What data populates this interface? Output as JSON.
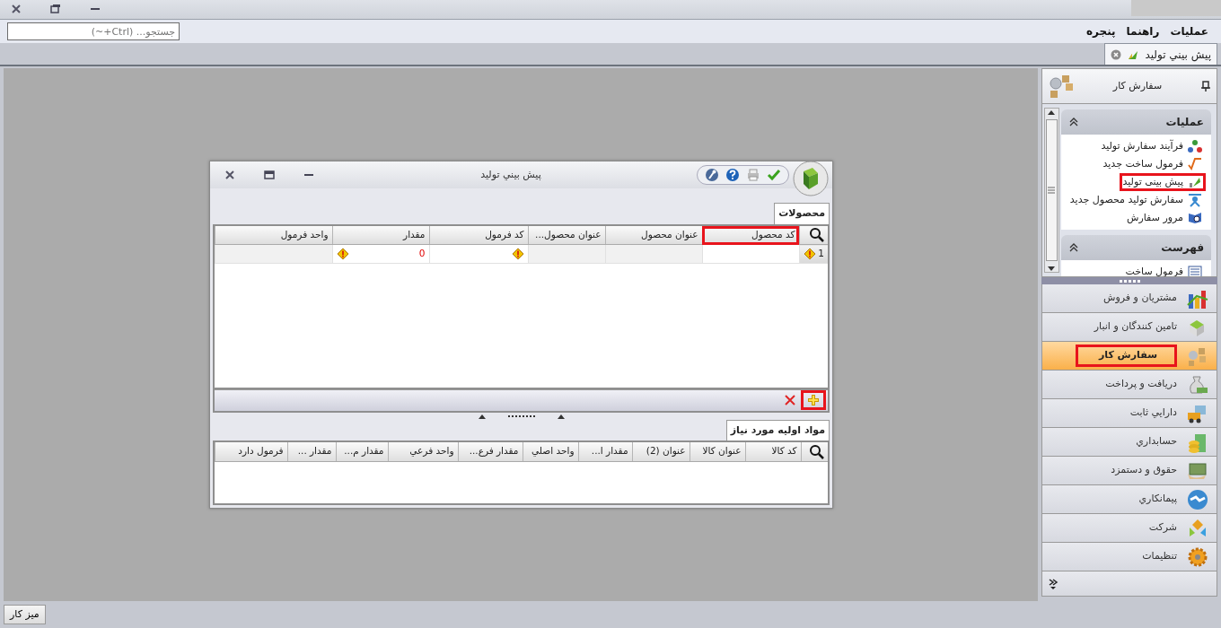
{
  "menu": [
    {
      "label": "عملیات"
    },
    {
      "label": "راهنما"
    },
    {
      "label": "پنجره"
    }
  ],
  "search": {
    "placeholder": "جستجو... (Ctrl+~)"
  },
  "doc_tabs": [
    {
      "label": "پيش بيني توليد",
      "selected": true
    }
  ],
  "dialog": {
    "title": "پيش بيني توليد",
    "sections": [
      {
        "tab": "محصولات",
        "columns": [
          {
            "label": "كد محصول",
            "highlighted": true
          },
          {
            "label": "عنوان محصول",
            "highlighted": false
          },
          {
            "label": "عنوان محصول...",
            "highlighted": false
          },
          {
            "label": "كد فرمول",
            "highlighted": false
          },
          {
            "label": "مقدار",
            "highlighted": false
          },
          {
            "label": "واحد فرمول",
            "highlighted": false
          }
        ],
        "rows": [
          {
            "row_header": "1",
            "warning": true,
            "cells": [
              {
                "warning": false,
                "disabled": false
              },
              {
                "warning": false,
                "disabled": true
              },
              {
                "warning": false,
                "disabled": true
              },
              {
                "warning": true,
                "disabled": false
              },
              {
                "text": "0",
                "warning": true,
                "disabled": false
              },
              {
                "warning": false,
                "disabled": true
              }
            ]
          }
        ],
        "footer": {
          "add_highlighted": true
        }
      },
      {
        "tab": "مواد اولیه مورد نیاز",
        "columns": [
          {
            "label": "كد كالا",
            "highlighted": false
          },
          {
            "label": "عنوان كالا",
            "highlighted": false
          },
          {
            "label": "عنوان (2)",
            "highlighted": false
          },
          {
            "label": "مقدار ا...",
            "highlighted": false
          },
          {
            "label": "واحد اصلي",
            "highlighted": false
          },
          {
            "label": "مقدار فرع...",
            "highlighted": false
          },
          {
            "label": "واحد فرعي",
            "highlighted": false
          },
          {
            "label": "مقدار م...",
            "highlighted": false
          },
          {
            "label": "مقدار ...",
            "highlighted": false
          },
          {
            "label": "فرمول دارد",
            "highlighted": false
          }
        ]
      }
    ]
  },
  "sidebar": {
    "title": "سفارش كار",
    "groups": [
      {
        "title": "عملیات",
        "expanded": true,
        "items": [
          {
            "label": "فرآیند سفارش تولید",
            "highlighted": false
          },
          {
            "label": "فرمول ساخت جدید",
            "highlighted": false
          },
          {
            "label": "پیش بینی تولید",
            "highlighted": true
          },
          {
            "label": "سفارش تولید محصول جدید",
            "highlighted": false
          },
          {
            "label": "مرور سفارش",
            "highlighted": false
          }
        ]
      },
      {
        "title": "فهرست",
        "expanded": true,
        "items": [
          {
            "label": "فرمول ساخت",
            "highlighted": false
          }
        ]
      }
    ],
    "nav": [
      {
        "label": "مشتريان و فروش",
        "selected": false,
        "highlighted": false
      },
      {
        "label": "تامين كنندگان و انبار",
        "selected": false,
        "highlighted": false
      },
      {
        "label": "سفارش كار",
        "selected": true,
        "highlighted": true
      },
      {
        "label": "دريافت و پرداخت",
        "selected": false,
        "highlighted": false
      },
      {
        "label": "دارايي ثابت",
        "selected": false,
        "highlighted": false
      },
      {
        "label": "حسابداري",
        "selected": false,
        "highlighted": false
      },
      {
        "label": "حقوق و دستمزد",
        "selected": false,
        "highlighted": false
      },
      {
        "label": "پيمانكاري",
        "selected": false,
        "highlighted": false
      },
      {
        "label": "شركت",
        "selected": false,
        "highlighted": false
      },
      {
        "label": "تنظيمات",
        "selected": false,
        "highlighted": false
      }
    ]
  },
  "taskbar_button": "ميز كار"
}
